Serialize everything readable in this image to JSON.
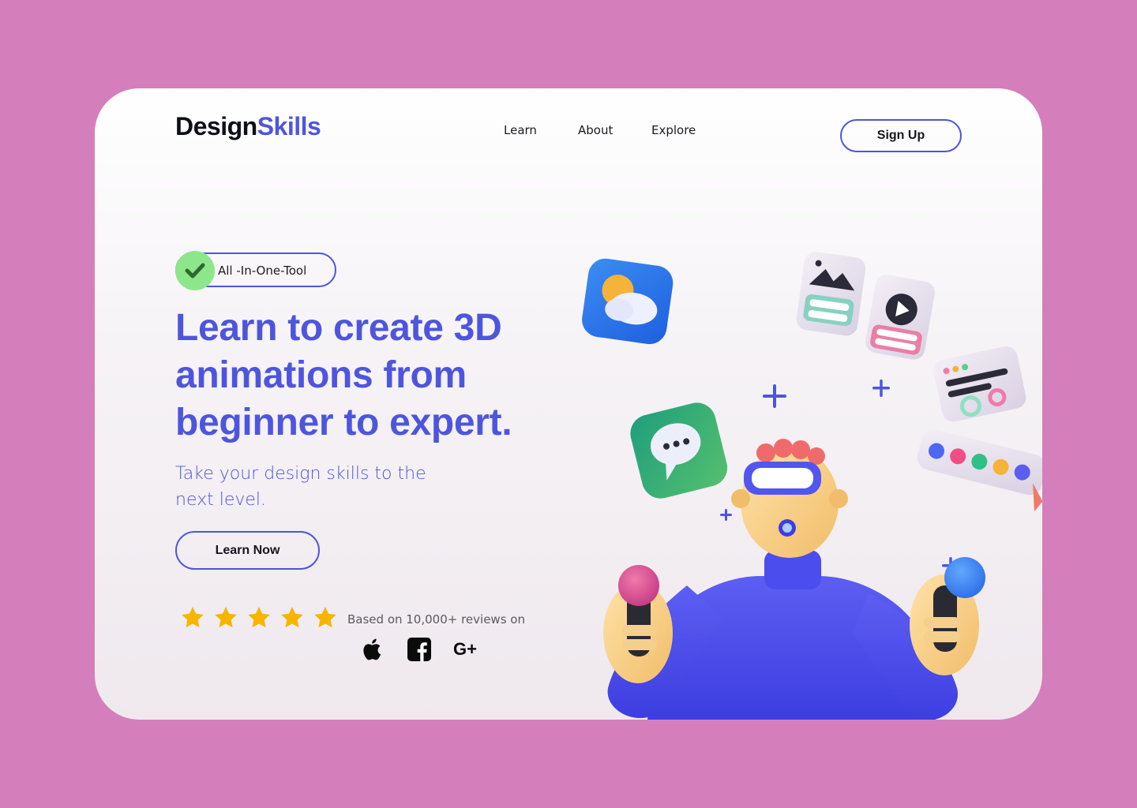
{
  "brand": {
    "name_part1": "Design",
    "name_part2": "Skills",
    "colors": {
      "accent": "#4e55dd",
      "dark": "#0e0e16",
      "frame": "#d47fbb",
      "check": "#8ee68a",
      "star": "#f7b500"
    }
  },
  "nav": {
    "items": [
      {
        "label": "Learn"
      },
      {
        "label": "About"
      },
      {
        "label": "Explore"
      }
    ],
    "signup_label": "Sign Up"
  },
  "hero": {
    "badge_label": "All -In-One-Tool",
    "badge_icon": "check-icon",
    "headline_lines": [
      "Learn to create 3D",
      "animations from",
      "beginner to expert."
    ],
    "subtitle_lines": [
      "Take your design skills to the",
      "next level."
    ],
    "cta_label": "Learn Now"
  },
  "reviews": {
    "rating": 5,
    "max_rating": 5,
    "text": "Based on 10,000+ reviews on",
    "platforms": [
      {
        "icon": "apple-icon"
      },
      {
        "icon": "facebook-icon"
      },
      {
        "icon": "google-plus-icon",
        "label": "G+"
      }
    ]
  }
}
